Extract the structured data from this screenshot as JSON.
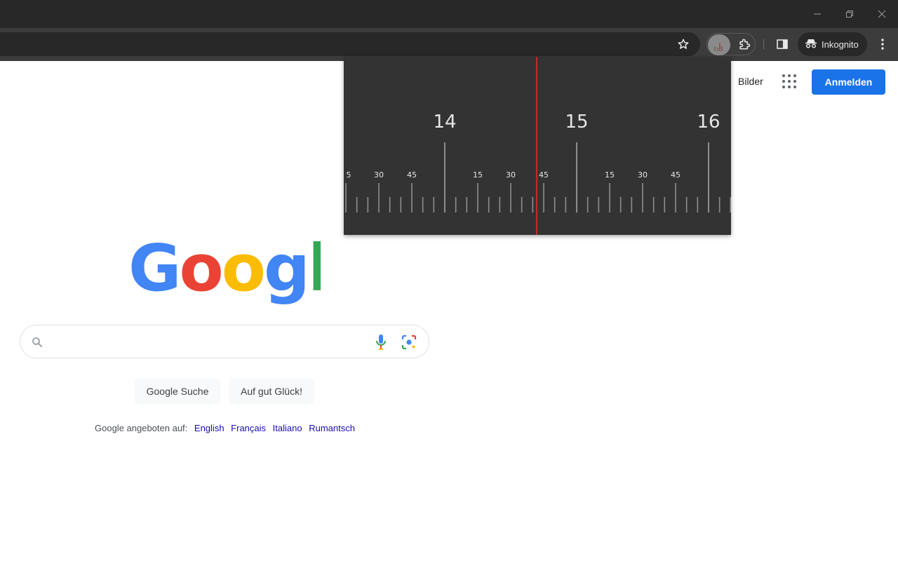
{
  "window": {
    "controls": [
      "minimize",
      "restore",
      "close"
    ]
  },
  "toolbar": {
    "bookmark_icon": "star-icon",
    "extension_icon": "puzzle-icon",
    "side_panel_icon": "side-panel-icon",
    "incognito_label": "Inkognito",
    "menu_icon": "kebab-menu-icon"
  },
  "page": {
    "nav_images": "Bilder",
    "apps_icon": "apps-grid-icon",
    "signin_label": "Anmelden",
    "logo_text": "Google",
    "search_placeholder": "",
    "search_value": "",
    "button_search": "Google Suche",
    "button_lucky": "Auf gut Glück!",
    "languages_prefix": "Google angeboten auf:",
    "languages": [
      "English",
      "Français",
      "Italiano",
      "Rumantsch"
    ]
  },
  "ruler_popup": {
    "major_labels": [
      "14",
      "15",
      "16"
    ],
    "minor_labels": [
      "15",
      "30",
      "45"
    ],
    "edge_minor_label": "5",
    "marker_color": "#c62828",
    "tick_color": "#8e8e8e"
  },
  "colors": {
    "accent": "#1a73e8",
    "link": "#1a0dab",
    "logo_blue": "#4285f4",
    "logo_red": "#ea4335",
    "logo_yellow": "#fbbc05",
    "logo_green": "#34a853"
  }
}
